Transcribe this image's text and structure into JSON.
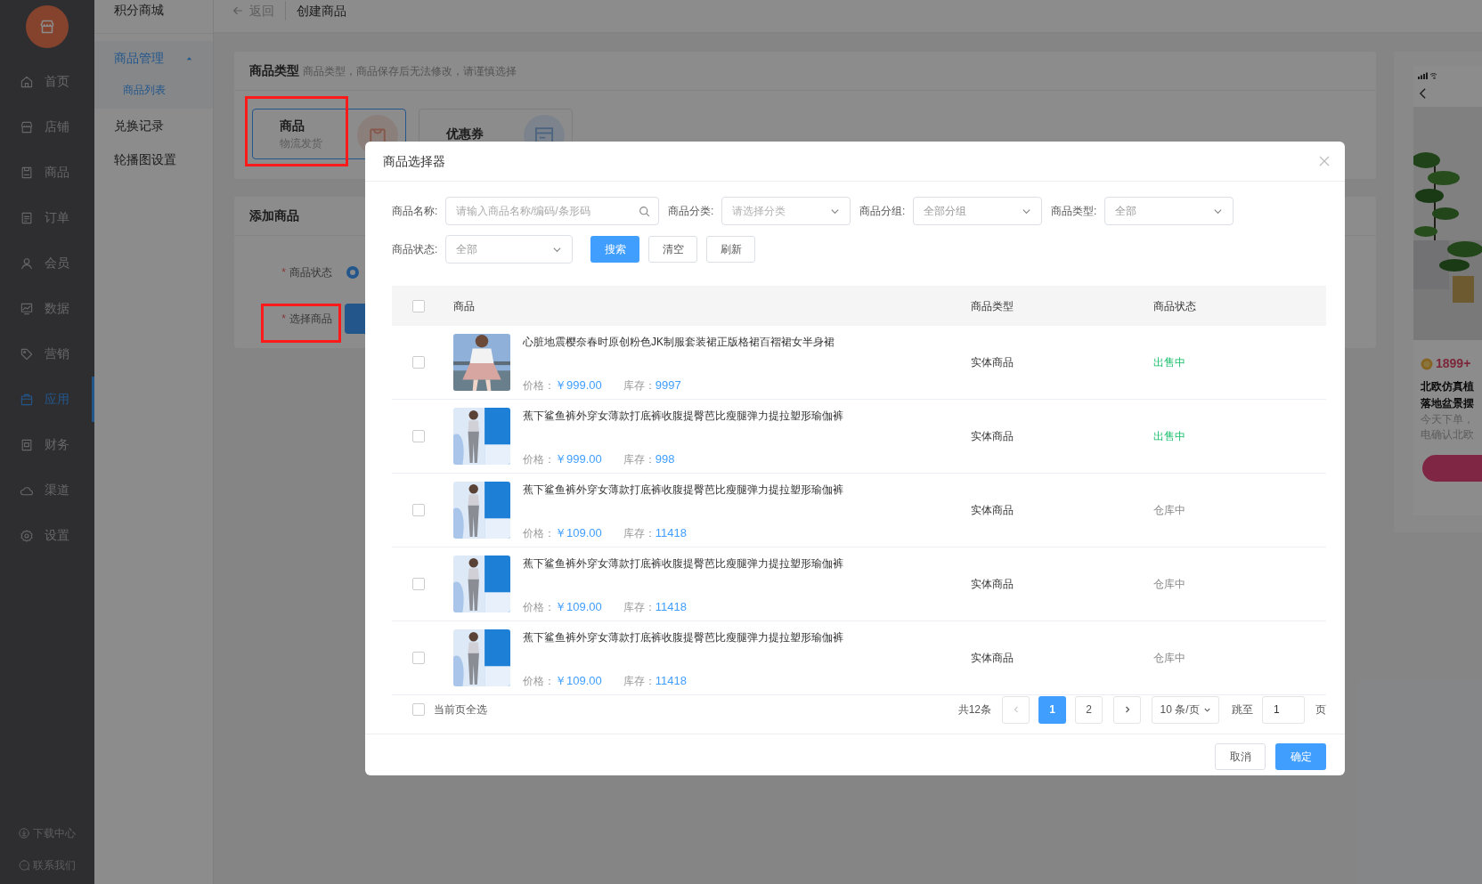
{
  "sidebar": {
    "nav": [
      {
        "label": "首页",
        "selected": false
      },
      {
        "label": "店铺",
        "selected": false
      },
      {
        "label": "商品",
        "selected": false
      },
      {
        "label": "订单",
        "selected": false
      },
      {
        "label": "会员",
        "selected": false
      },
      {
        "label": "数据",
        "selected": false
      },
      {
        "label": "营销",
        "selected": false
      },
      {
        "label": "应用",
        "selected": true
      },
      {
        "label": "财务",
        "selected": false
      },
      {
        "label": "渠道",
        "selected": false
      },
      {
        "label": "设置",
        "selected": false
      }
    ],
    "footer_links": [
      "下载中心",
      "联系我们"
    ]
  },
  "submenu": {
    "title": "积分商城",
    "items": [
      {
        "label": "商品管理",
        "kind": "group",
        "expanded": true,
        "children": [
          {
            "label": "商品列表",
            "selected": true
          }
        ]
      },
      {
        "label": "兑换记录",
        "kind": "link"
      },
      {
        "label": "轮播图设置",
        "kind": "link"
      }
    ]
  },
  "header": {
    "back": "返回",
    "title": "创建商品"
  },
  "type_card": {
    "title": "商品类型",
    "hint": "商品类型，商品保存后无法修改，请谨慎选择",
    "options": [
      {
        "title": "商品",
        "subtitle": "物流发货",
        "selected": true,
        "highlighted": true
      },
      {
        "title": "优惠券",
        "selected": false,
        "highlighted": false
      }
    ]
  },
  "add_card": {
    "title": "添加商品",
    "fields": [
      {
        "label": "商品状态",
        "required_mark": "*",
        "highlighted": false,
        "kind": "radio",
        "checked": true
      },
      {
        "label": "选择商品",
        "required_mark": "*",
        "highlighted": true,
        "kind": "button"
      }
    ]
  },
  "preview": {
    "price": "1899+",
    "title_lines": [
      "北欧仿真植",
      "落地盆景摆"
    ],
    "desc_lines": [
      "今天下单，",
      "电确认北欧"
    ]
  },
  "modal": {
    "title": "商品选择器",
    "filters": [
      {
        "label": "商品名称:",
        "kind": "search",
        "placeholder": "请输入商品名称/编码/条形码"
      },
      {
        "label": "商品分类:",
        "kind": "select",
        "placeholder": "请选择分类"
      },
      {
        "label": "商品分组:",
        "kind": "select",
        "value": "全部分组"
      },
      {
        "label": "商品类型:",
        "kind": "select",
        "value": "全部"
      },
      {
        "label": "商品状态:",
        "kind": "select",
        "value": "全部"
      }
    ],
    "buttons": [
      {
        "label": "搜索",
        "primary": true
      },
      {
        "label": "清空",
        "primary": false
      },
      {
        "label": "刷新",
        "primary": false
      }
    ],
    "table": {
      "header_checked": false,
      "columns": [
        "商品",
        "商品类型",
        "商品状态"
      ],
      "rows": [
        {
          "checked": false,
          "kind": "on_sale",
          "title": "心脏地震樱奈春时原创粉色JK制服套装裙正版格裙百褶裙女半身裙",
          "price_label": "价格：",
          "price": "￥999.00",
          "stock_label": "库存：",
          "stock": "9997",
          "type": "实体商品",
          "status": "出售中"
        },
        {
          "checked": false,
          "kind": "on_sale",
          "title": "蕉下鲨鱼裤外穿女薄款打底裤收腹提臀芭比瘦腿弹力提拉塑形瑜伽裤",
          "price_label": "价格：",
          "price": "￥999.00",
          "stock_label": "库存：",
          "stock": "998",
          "type": "实体商品",
          "status": "出售中"
        },
        {
          "checked": false,
          "kind": "in_stock",
          "title": "蕉下鲨鱼裤外穿女薄款打底裤收腹提臀芭比瘦腿弹力提拉塑形瑜伽裤",
          "price_label": "价格：",
          "price": "￥109.00",
          "stock_label": "库存：",
          "stock": "11418",
          "type": "实体商品",
          "status": "仓库中"
        },
        {
          "checked": false,
          "kind": "in_stock",
          "title": "蕉下鲨鱼裤外穿女薄款打底裤收腹提臀芭比瘦腿弹力提拉塑形瑜伽裤",
          "price_label": "价格：",
          "price": "￥109.00",
          "stock_label": "库存：",
          "stock": "11418",
          "type": "实体商品",
          "status": "仓库中"
        },
        {
          "checked": false,
          "kind": "in_stock",
          "title": "蕉下鲨鱼裤外穿女薄款打底裤收腹提臀芭比瘦腿弹力提拉塑形瑜伽裤",
          "price_label": "价格：",
          "price": "￥109.00",
          "stock_label": "库存：",
          "stock": "11418",
          "type": "实体商品",
          "status": "仓库中"
        }
      ]
    },
    "select_all": {
      "label": "当前页全选",
      "checked": false
    },
    "pagination": {
      "total": "共12条",
      "pages": [
        {
          "label": "1",
          "selected": true
        },
        {
          "label": "2",
          "selected": false
        }
      ],
      "page_size": "10 条/页",
      "jump_label": "跳至",
      "jump_value": "1",
      "page_suffix": "页"
    },
    "footer_buttons": [
      {
        "label": "取消",
        "primary": false
      },
      {
        "label": "确定",
        "primary": true
      }
    ]
  }
}
